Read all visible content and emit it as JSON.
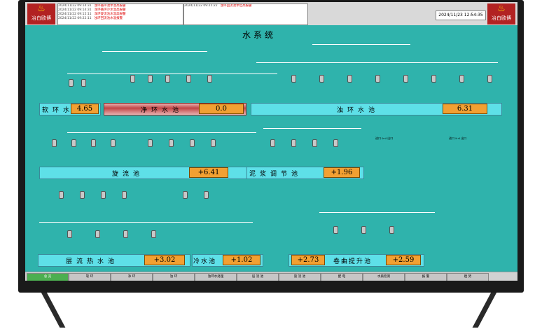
{
  "header": {
    "brand_left": "冶白欧博",
    "brand_right": "冶白欧博",
    "clock": "2024/11/23 12:54:35",
    "alarms_left": [
      {
        "time": "2024/11/22 09:14:31",
        "msg": "浊环循环池水温高报警"
      },
      {
        "time": "2024/11/22 09:14:31",
        "msg": "净环循环冷水温高报警"
      },
      {
        "time": "2024/11/22 09:15:11",
        "msg": "净环旋流池水温高报警"
      },
      {
        "time": "2024/11/22 09:22:11",
        "msg": "浊环回流池水温报警"
      }
    ],
    "alarms_right": [
      {
        "time": "2024/11/22 09:25:22",
        "msg": "浊环回流池水位高报警"
      }
    ]
  },
  "title": "水系统",
  "tanks": {
    "soft": {
      "label": "软环水池",
      "value": "4.65"
    },
    "clean": {
      "label": "净环水池",
      "value": "0.0"
    },
    "dirty": {
      "label": "浊环水池",
      "value": "6.31"
    },
    "cyclone": {
      "label": "旋流池",
      "value": "+6.41"
    },
    "sludge": {
      "label": "泥浆调节池",
      "value": "+1.96"
    },
    "heat": {
      "label": "层流热水池",
      "value": "+3.02"
    },
    "cold": {
      "label": "冷水池",
      "value": "+1.02"
    },
    "lift_left_value": "+2.73",
    "lift": {
      "label": "卷曲提升池",
      "value": "+2.59"
    }
  },
  "pump_label": "电流",
  "nav": [
    "总 览",
    "软 环",
    "净 环",
    "浊 环",
    "浊环水处理",
    "层 流 池",
    "旋 流 池",
    "配 电",
    "水质检测",
    "报 警",
    "趋 势"
  ],
  "nav_selected": 0,
  "colors": {
    "screen": "#2fb3ac",
    "tank": "#5ee0e8",
    "value": "#f2a032"
  }
}
